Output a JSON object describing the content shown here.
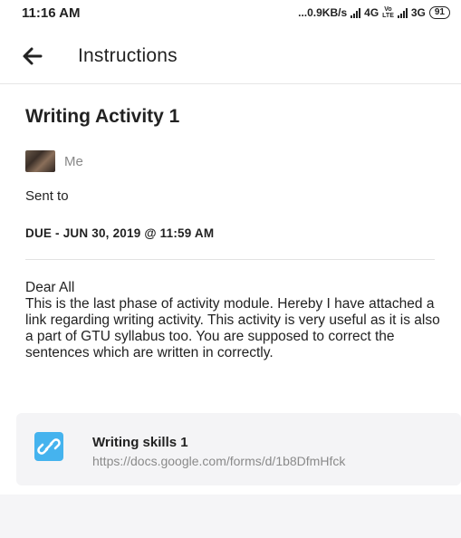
{
  "status_bar": {
    "time": "11:16 AM",
    "net_speed": "...0.9KB/s",
    "network_4g": "4G",
    "volte_top": "Vo",
    "volte_bottom": "LTE",
    "network_3g": "3G",
    "battery": "91"
  },
  "header": {
    "back_icon": "arrow-left-icon",
    "title": "Instructions"
  },
  "post": {
    "title": "Writing Activity 1",
    "author": "Me",
    "sent_to_label": "Sent to",
    "due": "DUE - JUN 30, 2019 @ 11:59 AM",
    "greeting": "Dear All",
    "body": "This is the last phase of activity module. Hereby I have attached a link regarding writing activity. This activity is very useful as it is also a part of GTU syllabus too. You are supposed to correct the sentences which are written in correctly."
  },
  "attachment": {
    "icon": "link-icon",
    "icon_color": "#45b3ee",
    "title": "Writing skills 1",
    "url": "https://docs.google.com/forms/d/1b8DfmHfck"
  }
}
